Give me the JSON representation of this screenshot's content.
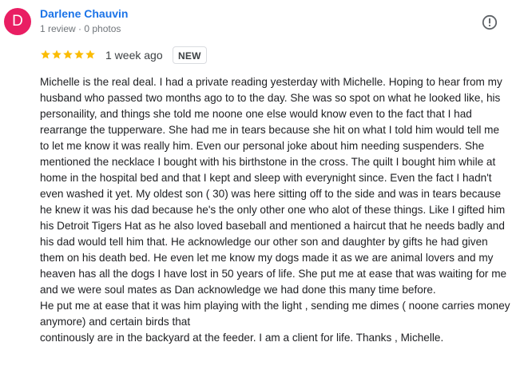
{
  "reviewer": {
    "avatar_letter": "D",
    "avatar_color": "#e91e63",
    "name": "Darlene Chauvin",
    "meta": "1 review · 0 photos"
  },
  "report_icon": "report-flag-icon",
  "rating": {
    "stars": 5,
    "max": 5,
    "star_color": "#fbbc04",
    "time_ago": "1 week ago",
    "badge": "NEW"
  },
  "review": {
    "paragraphs": [
      "Michelle is the real deal. I had a private reading yesterday with Michelle. Hoping to hear from my husband who passed two months ago to to the day. She was so spot on what he looked like, his personaility, and things she told me noone one else would know even to the fact that I had rearrange the tupperware. She had me in tears because she hit on what I told him would tell me to let me know it was really him. Even our personal joke about him needing suspenders. She mentioned the necklace I bought with his birthstone in the cross. The quilt I bought him while at home in the hospital bed and that I kept and sleep with everynight since. Even the fact I hadn't even washed it yet. My oldest son ( 30) was here sitting off to the side and was in tears because he knew it was his dad because he's the only other one who alot of these things. Like I gifted him his Detroit Tigers Hat as he also loved baseball and mentioned a haircut that he needs badly and his dad would tell him that. He acknowledge our other son and daughter by gifts he had given them on his death bed. He even let me know my dogs made it as we are animal lovers and my heaven has all the dogs I have lost in 50 years of life. She put me at ease that was waiting for me and we were soul mates as Dan acknowledge we had done this many time before.",
      "He put me at ease that it was him playing with the light , sending me dimes ( noone carries money anymore) and certain birds that",
      "continously are in the backyard at the feeder. I am a client for life. Thanks , Michelle."
    ]
  }
}
